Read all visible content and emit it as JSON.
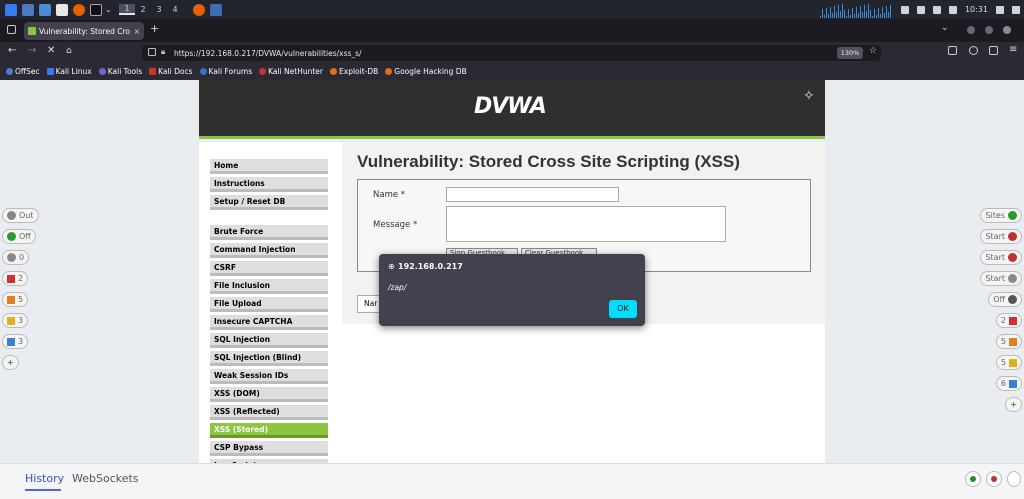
{
  "taskbar": {
    "workspaces": [
      "1",
      "2",
      "3",
      "4"
    ],
    "clock": "10:31"
  },
  "browser": {
    "tab_title": "Vulnerability: Stored Cro",
    "url": "https://192.168.0.217/DVWA/vulnerabilities/xss_s/",
    "zoom": "130%",
    "bookmarks": [
      "OffSec",
      "Kali Linux",
      "Kali Tools",
      "Kali Docs",
      "Kali Forums",
      "Kali NetHunter",
      "Exploit-DB",
      "Google Hacking DB"
    ]
  },
  "dvwa": {
    "logo": "DVWA",
    "title": "Vulnerability: Stored Cross Site Scripting (XSS)",
    "menu_top": [
      "Home",
      "Instructions",
      "Setup / Reset DB"
    ],
    "menu_vulns": [
      "Brute Force",
      "Command Injection",
      "CSRF",
      "File Inclusion",
      "File Upload",
      "Insecure CAPTCHA",
      "SQL Injection",
      "SQL Injection (Blind)",
      "Weak Session IDs",
      "XSS (DOM)",
      "XSS (Reflected)",
      "XSS (Stored)",
      "CSP Bypass",
      "JavaScript"
    ],
    "selected": "XSS (Stored)",
    "form": {
      "name_label": "Name *",
      "message_label": "Message *",
      "sign_button": "Sign Guestbook",
      "clear_button": "Clear Guestbook"
    },
    "below_fragment": "Nar"
  },
  "zap_left": [
    "Out",
    "Off",
    "0",
    "2",
    "5",
    "3",
    "3"
  ],
  "zap_right": [
    "Sites",
    "Start",
    "Start",
    "Start",
    "Off",
    "2",
    "5",
    "5",
    "6"
  ],
  "bottom_tabs": {
    "history": "History",
    "websockets": "WebSockets"
  },
  "dialog": {
    "host": "192.168.0.217",
    "message": "/zap/",
    "ok": "OK"
  }
}
